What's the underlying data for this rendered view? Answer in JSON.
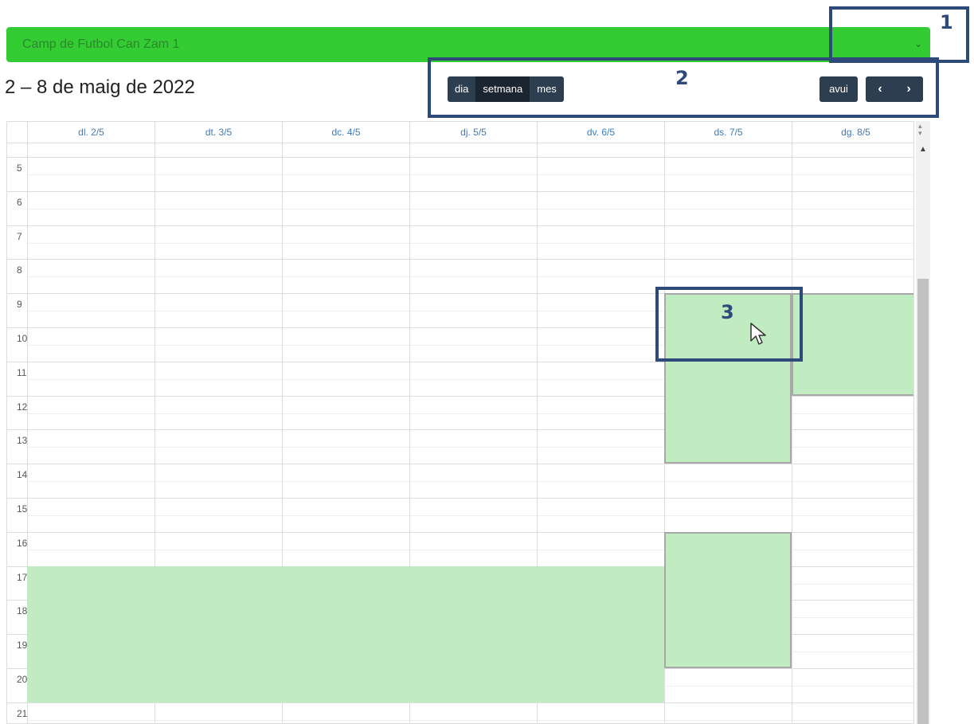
{
  "venue_select": {
    "value": "Camp de Futbol Can Zam 1"
  },
  "range_title": "2 – 8 de maig de 2022",
  "views": [
    "dia",
    "setmana",
    "mes"
  ],
  "active_view": "setmana",
  "today_label": "avui",
  "nav": {
    "prev": "‹",
    "next": "›"
  },
  "days": [
    "dl. 2/5",
    "dt. 3/5",
    "dc. 4/5",
    "dj. 5/5",
    "dv. 6/5",
    "ds. 7/5",
    "dg. 8/5"
  ],
  "hours": [
    "5",
    "6",
    "7",
    "8",
    "9",
    "10",
    "11",
    "12",
    "13",
    "14",
    "15",
    "16",
    "17",
    "18",
    "19",
    "20",
    "21"
  ],
  "available_slots": [
    {
      "days": [
        "dl. 2/5",
        "dt. 3/5",
        "dc. 4/5",
        "dj. 5/5",
        "dv. 6/5"
      ],
      "start": "17:00",
      "end": "21:00"
    },
    {
      "days": [
        "ds. 7/5"
      ],
      "start": "9:00",
      "end": "14:00"
    },
    {
      "days": [
        "ds. 7/5"
      ],
      "start": "16:00",
      "end": "20:00"
    },
    {
      "days": [
        "dg. 8/5"
      ],
      "start": "9:00",
      "end": "12:00"
    }
  ],
  "annotations": [
    "1",
    "2",
    "3"
  ],
  "colors": {
    "select_bg": "#33cc33",
    "button_bg": "#2c3e50",
    "slot_bg": "#c1ecc1",
    "annotation": "#2e4a7a",
    "day_header": "#3a7bbf"
  }
}
